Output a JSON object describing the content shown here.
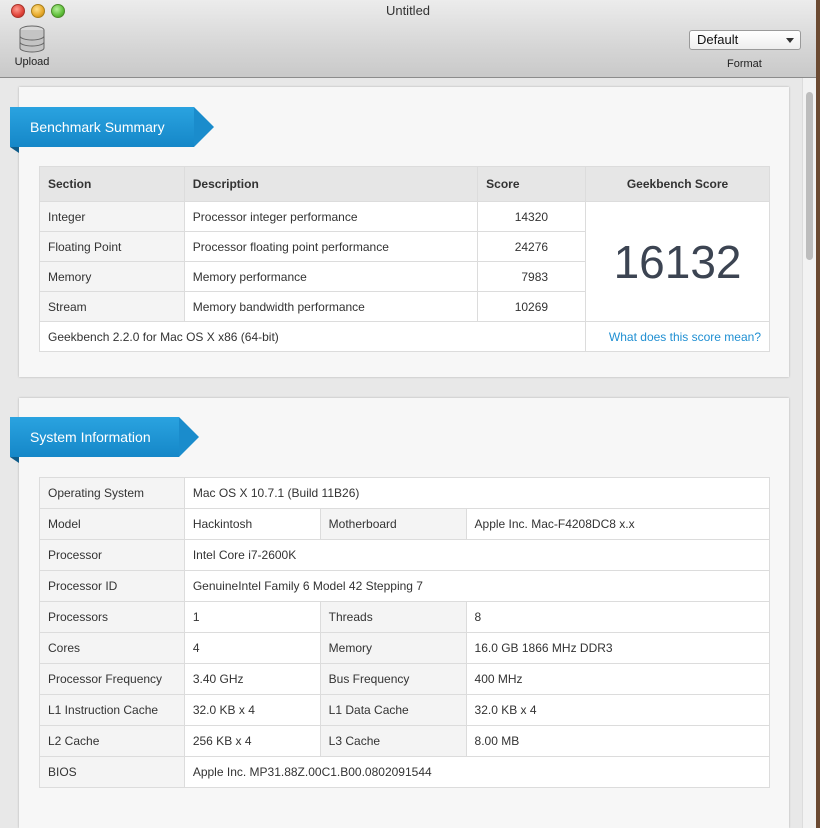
{
  "window": {
    "title": "Untitled"
  },
  "toolbar": {
    "upload_label": "Upload",
    "format_value": "Default",
    "format_label": "Format"
  },
  "benchmark": {
    "heading": "Benchmark Summary",
    "columns": [
      "Section",
      "Description",
      "Score",
      "Geekbench Score"
    ],
    "rows": [
      {
        "section": "Integer",
        "description": "Processor integer performance",
        "score": "14320"
      },
      {
        "section": "Floating Point",
        "description": "Processor floating point performance",
        "score": "24276"
      },
      {
        "section": "Memory",
        "description": "Memory performance",
        "score": "7983"
      },
      {
        "section": "Stream",
        "description": "Memory bandwidth performance",
        "score": "10269"
      }
    ],
    "geekbench_score": "16132",
    "version": "Geekbench 2.2.0 for Mac OS X x86 (64-bit)",
    "link": "What does this score mean?"
  },
  "system": {
    "heading": "System Information",
    "os_key": "Operating System",
    "os_val": "Mac OS X 10.7.1 (Build 11B26)",
    "model_key": "Model",
    "model_val": "Hackintosh",
    "mobo_key": "Motherboard",
    "mobo_val": "Apple Inc. Mac-F4208DC8 x.x",
    "proc_key": "Processor",
    "proc_val": "Intel Core i7-2600K",
    "procid_key": "Processor ID",
    "procid_val": "GenuineIntel Family 6 Model 42 Stepping 7",
    "procs_key": "Processors",
    "procs_val": "1",
    "threads_key": "Threads",
    "threads_val": "8",
    "cores_key": "Cores",
    "cores_val": "4",
    "mem_key": "Memory",
    "mem_val": "16.0 GB 1866 MHz DDR3",
    "freq_key": "Processor Frequency",
    "freq_val": "3.40 GHz",
    "bus_key": "Bus Frequency",
    "bus_val": "400 MHz",
    "l1i_key": "L1 Instruction Cache",
    "l1i_val": "32.0 KB x 4",
    "l1d_key": "L1 Data Cache",
    "l1d_val": "32.0 KB x 4",
    "l2_key": "L2 Cache",
    "l2_val": "256 KB x 4",
    "l3_key": "L3 Cache",
    "l3_val": "8.00 MB",
    "bios_key": "BIOS",
    "bios_val": "Apple Inc. MP31.88Z.00C1.B00.0802091544"
  },
  "colors": {
    "accent": "#1f8fd2",
    "ribbon": "#1a8ccc"
  }
}
